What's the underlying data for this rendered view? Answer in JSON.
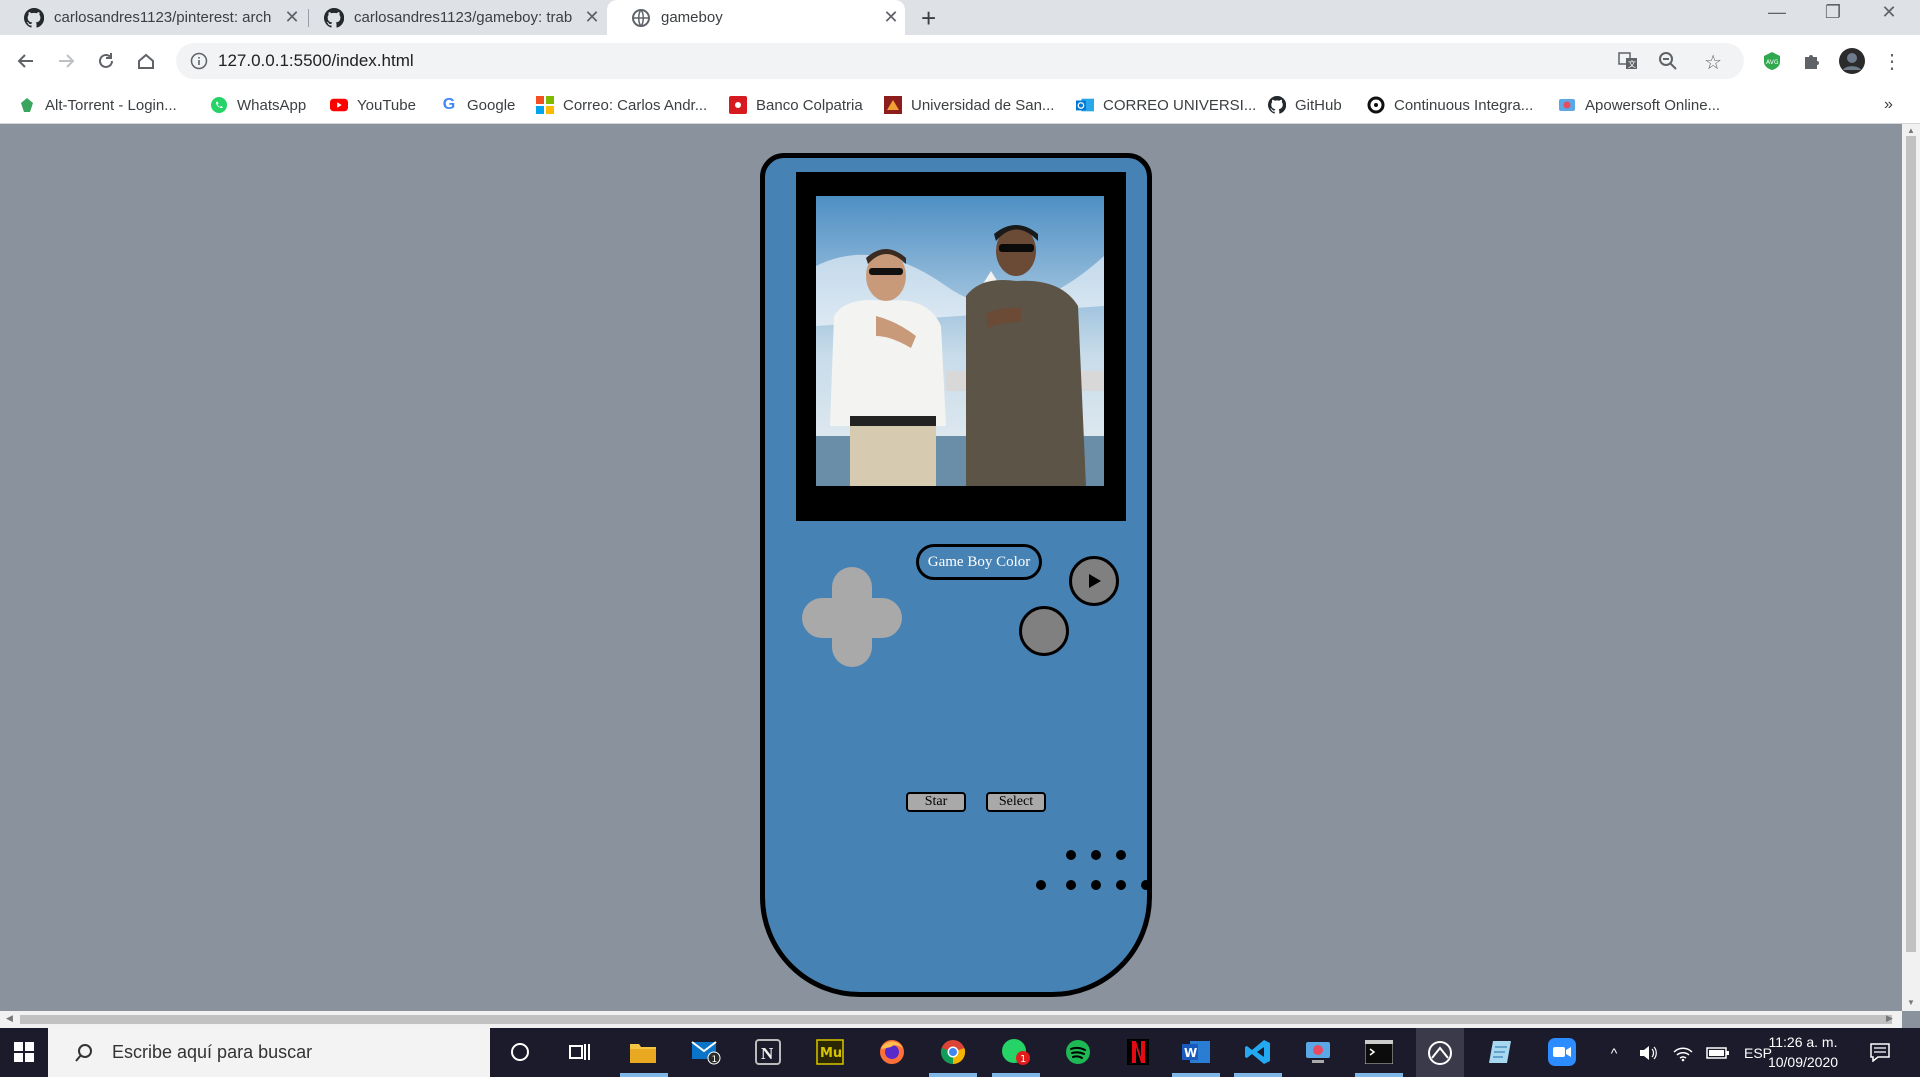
{
  "tabs": [
    {
      "title": "carlosandres1123/pinterest: arch",
      "icon": "github-icon"
    },
    {
      "title": "carlosandres1123/gameboy: trab",
      "icon": "github-icon"
    },
    {
      "title": "gameboy",
      "icon": "globe-icon",
      "active": true
    }
  ],
  "address_bar": {
    "url": "127.0.0.1:5500/index.html"
  },
  "bookmarks": [
    {
      "label": "Alt-Torrent - Login...",
      "icon": "alt-torrent-icon"
    },
    {
      "label": "WhatsApp",
      "icon": "whatsapp-icon"
    },
    {
      "label": "YouTube",
      "icon": "youtube-icon"
    },
    {
      "label": "Google",
      "icon": "google-icon"
    },
    {
      "label": "Correo: Carlos Andr...",
      "icon": "microsoft-icon"
    },
    {
      "label": "Banco Colpatria",
      "icon": "colpatria-icon"
    },
    {
      "label": "Universidad de San...",
      "icon": "university-icon"
    },
    {
      "label": "CORREO UNIVERSI...",
      "icon": "outlook-icon"
    },
    {
      "label": "GitHub",
      "icon": "github-icon"
    },
    {
      "label": "Continuous Integra...",
      "icon": "ci-icon"
    },
    {
      "label": "Apowersoft Online...",
      "icon": "apowersoft-icon"
    }
  ],
  "gameboy": {
    "title_label": "Game Boy Color",
    "start_label": "Star",
    "select_label": "Select",
    "colors": {
      "body": "#4682b4",
      "page_bg": "#8a929e",
      "dpad": "#a9a9a9",
      "button": "#808080"
    }
  },
  "taskbar": {
    "search_placeholder": "Escribe aquí para buscar",
    "mail_badge": "1",
    "whatsapp_badge": "1",
    "language": "ESP",
    "time": "11:26 a. m.",
    "date": "10/09/2020"
  }
}
